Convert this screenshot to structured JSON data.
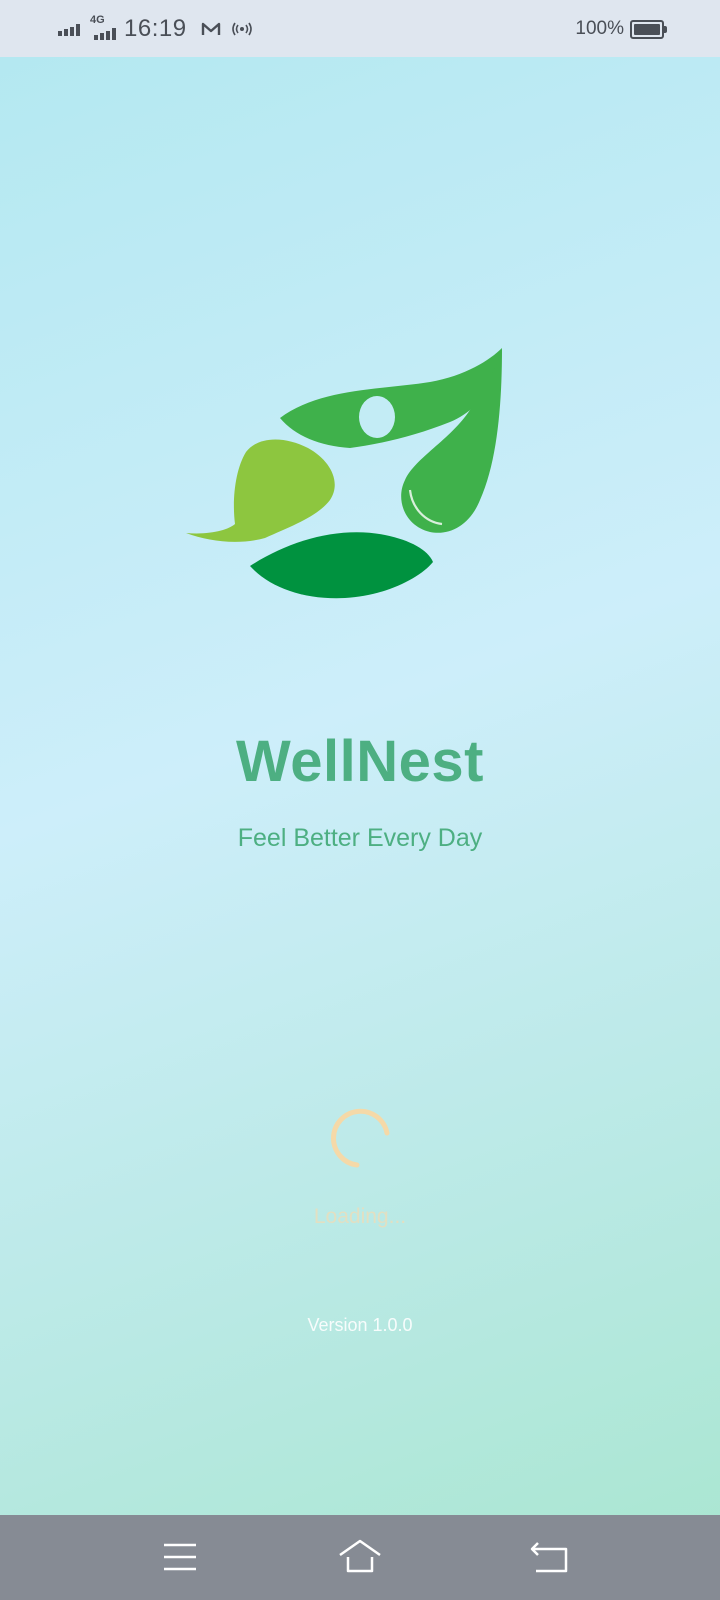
{
  "status_bar": {
    "network": "4G",
    "time": "16:19",
    "battery_percent": "100%",
    "battery_level": 1.0,
    "icons": [
      "signal-icon",
      "4g-signal-icon",
      "gmail-icon",
      "hotspot-icon",
      "battery-icon"
    ]
  },
  "app": {
    "title": "WellNest",
    "tagline": "Feel Better Every Day",
    "loading_text": "Loading...",
    "version": "Version 1.0.0"
  },
  "nav_bar": {
    "buttons": [
      "menu-icon",
      "home-icon",
      "back-icon"
    ]
  },
  "colors": {
    "title": "#4daf82",
    "spinner": "#f5d9a8",
    "leaf_light": "#8dc63f",
    "leaf_mid": "#3fb14b",
    "leaf_dark": "#00923f"
  }
}
